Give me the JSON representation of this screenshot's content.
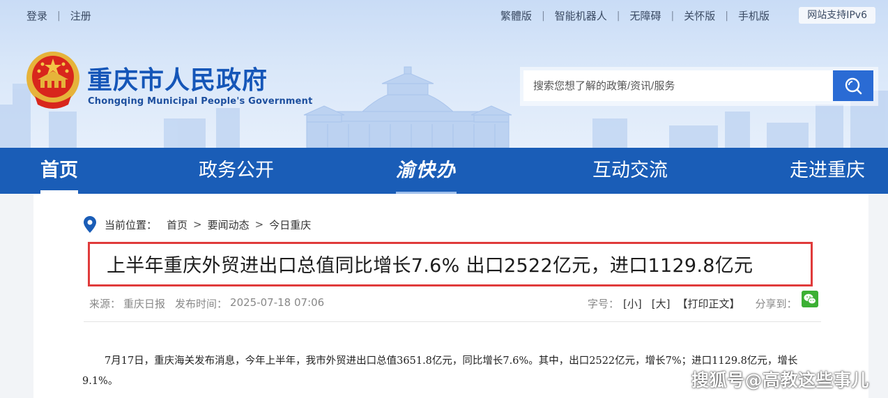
{
  "top_bar": {
    "left_links": [
      "登录",
      "注册"
    ],
    "right_links": [
      "繁體版",
      "智能机器人",
      "无障碍",
      "关怀版",
      "手机版"
    ],
    "ipv6_badge": "网站支持IPv6"
  },
  "header": {
    "title": "重庆市人民政府",
    "subtitle": "Chongqing Municipal People's Government",
    "search_placeholder": "搜索您想了解的政策/资讯/服务"
  },
  "nav": {
    "items": [
      "首页",
      "政务公开",
      "渝快办",
      "互动交流",
      "走进重庆"
    ],
    "active": "首页"
  },
  "breadcrumb": {
    "label": "当前位置：",
    "crumbs": [
      "首页",
      "要闻动态",
      "今日重庆"
    ],
    "separator": ">"
  },
  "article": {
    "title": "上半年重庆外贸进出口总值同比增长7.6% 出口2522亿元，进口1129.8亿元",
    "source_label": "来源：",
    "source": "重庆日报",
    "published_label": "发布时间：",
    "published": "2025-07-18 07:06",
    "font_size_label": "字号：",
    "font_small": "[小]",
    "font_large": "[大]",
    "print_label": "【打印正文】",
    "share_label": "分享到：",
    "body": "7月17日，重庆海关发布消息，今年上半年，我市外贸进出口总值3651.8亿元，同比增长7.6%。其中，出口2522亿元，增长7%；进口1129.8亿元，增长9.1%。"
  },
  "watermark": "搜狐号@高教这些事儿",
  "colors": {
    "nav_blue": "#1a5db7",
    "title_blue": "#1556b8",
    "highlight_red": "#e03b3b",
    "search_button": "#2a6bd4",
    "wechat_green": "#3cb034"
  },
  "icons": {
    "search": "search-icon",
    "location": "location-pin-icon",
    "share": "wechat-icon",
    "emblem": "national-emblem-icon"
  }
}
